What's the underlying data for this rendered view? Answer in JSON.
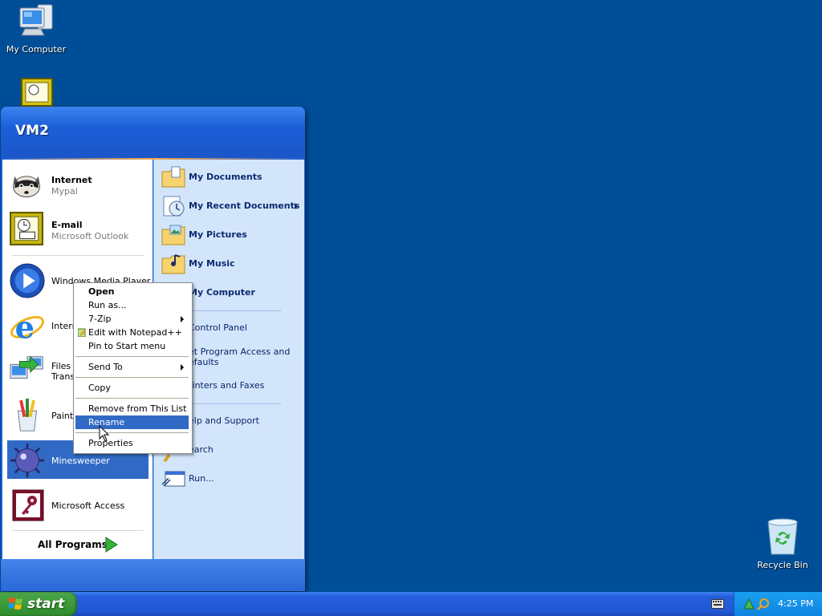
{
  "desktop": {
    "icons": [
      {
        "label": "My Computer"
      },
      {
        "label": "Recycle Bin"
      }
    ]
  },
  "start_menu": {
    "user": "VM2",
    "pinned": [
      {
        "title": "Internet",
        "subtitle": "Mypal"
      },
      {
        "title": "E-mail",
        "subtitle": "Microsoft Outlook"
      }
    ],
    "recent": [
      {
        "label": "Windows Media Player"
      },
      {
        "label": "Internet Explorer"
      },
      {
        "label": "Files and Settings Transfer Wizard"
      },
      {
        "label": "Paint"
      },
      {
        "label": "Minesweeper"
      },
      {
        "label": "Microsoft Access"
      }
    ],
    "recent_visible": {
      "wmp": "Windows Media Player",
      "ie": "Intern",
      "files_line1": "Files a",
      "files_line2": "Transf",
      "paint": "Paint",
      "minesweeper": "Minesweeper",
      "access": "Microsoft Access"
    },
    "all_programs": "All Programs",
    "right": {
      "my_documents": "My Documents",
      "my_recent_documents": "My Recent Documents",
      "my_pictures": "My Pictures",
      "my_music": "My Music",
      "my_computer": "My Computer",
      "control_panel": "Control Panel",
      "set_program_access_l1": "Set Program Access and",
      "set_program_access_l2": "Defaults",
      "printers": "Printers and Faxes",
      "help": "Help and Support",
      "search": "Search",
      "run": "Run..."
    },
    "right_visible": {
      "my_computer": "My Computer",
      "control_panel": "Control Panel",
      "set_l1": "et Program Access and",
      "set_l2": "efaults",
      "printers": "rinters and Faxes",
      "help": "elp and Support",
      "search": "earch"
    }
  },
  "context_menu": {
    "items": {
      "open": "Open",
      "run_as": "Run as...",
      "zip": "7-Zip",
      "notepad": "Edit with Notepad++",
      "pin": "Pin to Start menu",
      "send_to": "Send To",
      "copy": "Copy",
      "remove": "Remove from This List",
      "rename": "Rename",
      "properties": "Properties"
    },
    "highlighted": "Rename"
  },
  "taskbar": {
    "start_label": "start",
    "clock": "4:25 PM"
  },
  "colors": {
    "desktop": "#004e98",
    "selection": "#316ac5",
    "start_green": "#3c9a3a",
    "tray_blue": "#0f84e0"
  }
}
